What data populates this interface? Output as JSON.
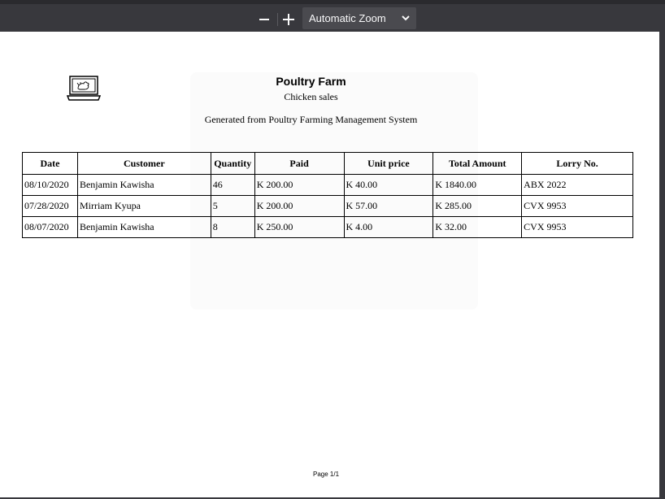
{
  "toolbar": {
    "zoom_out_icon": "minus-icon",
    "zoom_in_icon": "plus-icon",
    "zoom_value": "Automatic Zoom"
  },
  "document": {
    "title": "Poultry Farm",
    "subtitle": "Chicken sales",
    "generated": "Generated from Poultry Farming Management System",
    "footer": "Page 1/1",
    "columns": [
      "Date",
      "Customer",
      "Quantity",
      "Paid",
      "Unit price",
      "Total Amount",
      "Lorry No."
    ],
    "rows": [
      [
        "08/10/2020",
        "Benjamin Kawisha",
        "46",
        "K 200.00",
        "K 40.00",
        "K 1840.00",
        "ABX 2022"
      ],
      [
        "07/28/2020",
        "Mirriam Kyupa",
        "5",
        "K 200.00",
        "K 57.00",
        "K 285.00",
        "CVX 9953"
      ],
      [
        "08/07/2020",
        "Benjamin Kawisha",
        "8",
        "K 250.00",
        "K 4.00",
        "K 32.00",
        "CVX 9953"
      ]
    ]
  }
}
